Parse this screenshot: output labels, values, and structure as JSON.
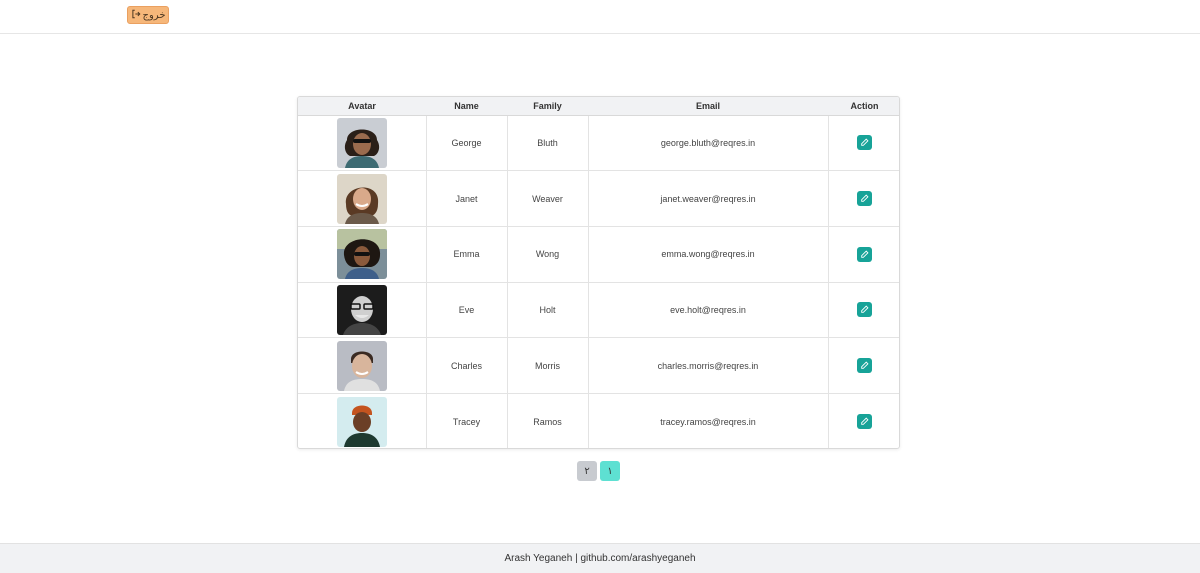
{
  "header": {
    "logout_label": "خروج",
    "logout_icon": "logout-icon"
  },
  "table": {
    "columns": [
      "Avatar",
      "Name",
      "Family",
      "Email",
      "Action"
    ],
    "rows": [
      {
        "name": "George",
        "family": "Bluth",
        "email": "george.bluth@reqres.in"
      },
      {
        "name": "Janet",
        "family": "Weaver",
        "email": "janet.weaver@reqres.in"
      },
      {
        "name": "Emma",
        "family": "Wong",
        "email": "emma.wong@reqres.in"
      },
      {
        "name": "Eve",
        "family": "Holt",
        "email": "eve.holt@reqres.in"
      },
      {
        "name": "Charles",
        "family": "Morris",
        "email": "charles.morris@reqres.in"
      },
      {
        "name": "Tracey",
        "family": "Ramos",
        "email": "tracey.ramos@reqres.in"
      }
    ],
    "action_icon": "edit-icon"
  },
  "pagination": {
    "pages": [
      "۲",
      "۱"
    ],
    "active_page": "۱"
  },
  "footer": {
    "text": "Arash Yeganeh | github.com/arashyeganeh"
  },
  "colors": {
    "logout_bg": "#f6b77a",
    "edit_bg": "#17a398",
    "page_active": "#5ee0d2",
    "page_inactive": "#c8cbd0"
  }
}
